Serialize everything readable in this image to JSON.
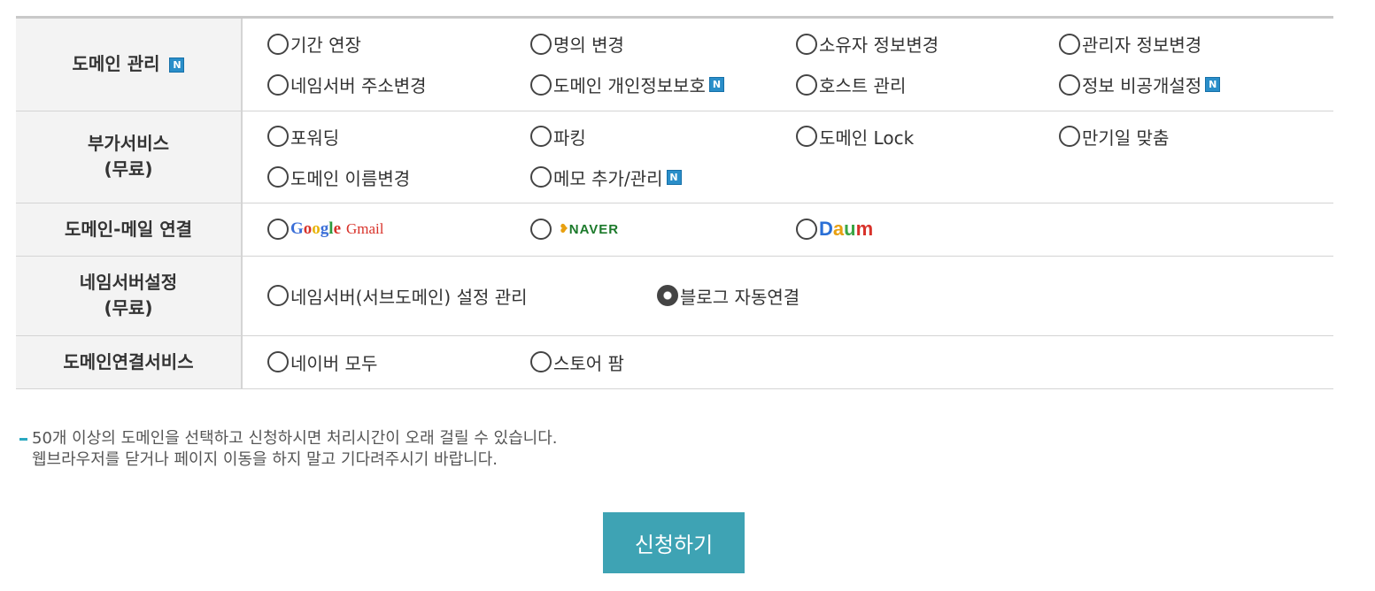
{
  "rows": {
    "domain_mgmt": {
      "label": "도메인 관리",
      "badge": "N",
      "options": [
        "기간 연장",
        "명의 변경",
        "소유자 정보변경",
        "관리자 정보변경",
        "네임서버 주소변경",
        "도메인 개인정보보호",
        "호스트 관리",
        "정보 비공개설정"
      ]
    },
    "extra": {
      "label_line1": "부가서비스",
      "label_line2": "(무료)",
      "options": [
        "포워딩",
        "파킹",
        "도메인 Lock",
        "만기일 맞춤",
        "도메인 이름변경",
        "메모 추가/관리"
      ]
    },
    "mail": {
      "label": "도메인-메일 연결",
      "google": {
        "text": "Google",
        "g_letters": [
          "G",
          "o",
          "o",
          "g",
          "l",
          "e"
        ],
        "gmail": "Gmail"
      },
      "naver": "NAVER",
      "daum": {
        "letters": [
          "D",
          "a",
          "u",
          "m"
        ]
      }
    },
    "ns": {
      "label_line1": "네임서버설정",
      "label_line2": "(무료)",
      "options": [
        "네임서버(서브도메인) 설정 관리",
        "블로그 자동연결"
      ],
      "selected": "블로그 자동연결"
    },
    "connect": {
      "label": "도메인연결서비스",
      "options": [
        "네이버 모두",
        "스토어 팜"
      ]
    }
  },
  "notice": {
    "line1": "50개 이상의 도메인을 선택하고 신청하시면 처리시간이 오래 걸릴 수 있습니다.",
    "line2": "웹브라우저를 닫거나 페이지 이동을 하지 말고 기다려주시기 바랍니다."
  },
  "submit_label": "신청하기",
  "colors": {
    "badge": "#2a8ec9",
    "button": "#3ea3b4",
    "notice_dash": "#2aa8c0"
  }
}
